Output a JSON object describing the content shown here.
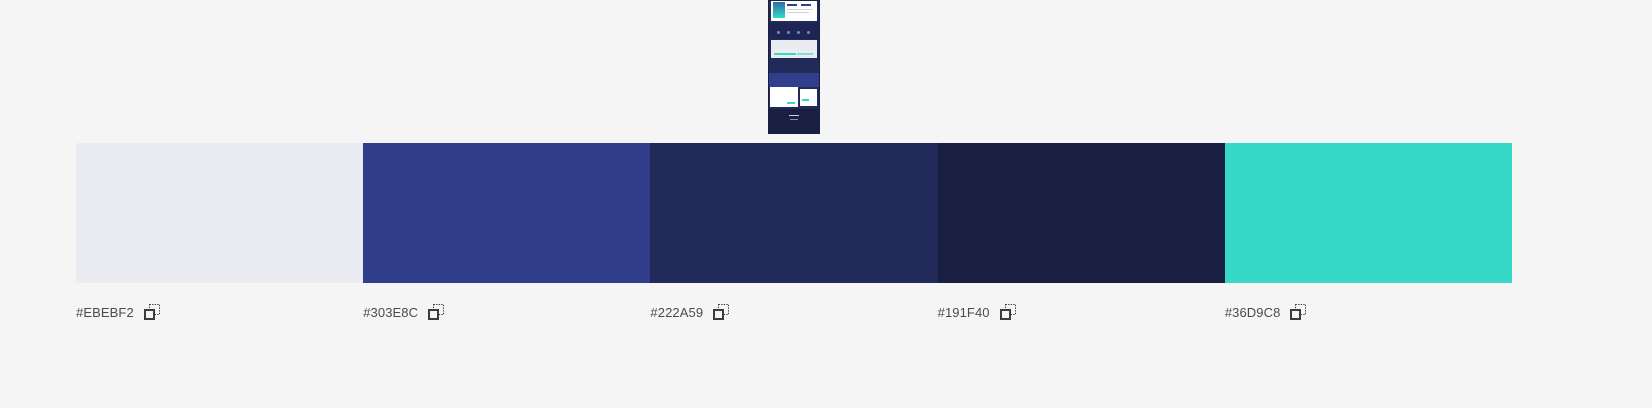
{
  "thumbnail": {
    "icon": "website-preview-thumbnail"
  },
  "palette": {
    "swatches": [
      {
        "color": "#EBEBF2",
        "hex_label": "#EBEBF2",
        "copy_icon": "copy-icon"
      },
      {
        "color": "#303E8C",
        "hex_label": "#303E8C",
        "copy_icon": "copy-icon"
      },
      {
        "color": "#222A59",
        "hex_label": "#222A59",
        "copy_icon": "copy-icon"
      },
      {
        "color": "#191F40",
        "hex_label": "#191F40",
        "copy_icon": "copy-icon"
      },
      {
        "color": "#36D9C8",
        "hex_label": "#36D9C8",
        "copy_icon": "copy-icon"
      }
    ]
  },
  "colors": {
    "background": "#f5f5f5",
    "label_text": "#4b4b4b"
  }
}
